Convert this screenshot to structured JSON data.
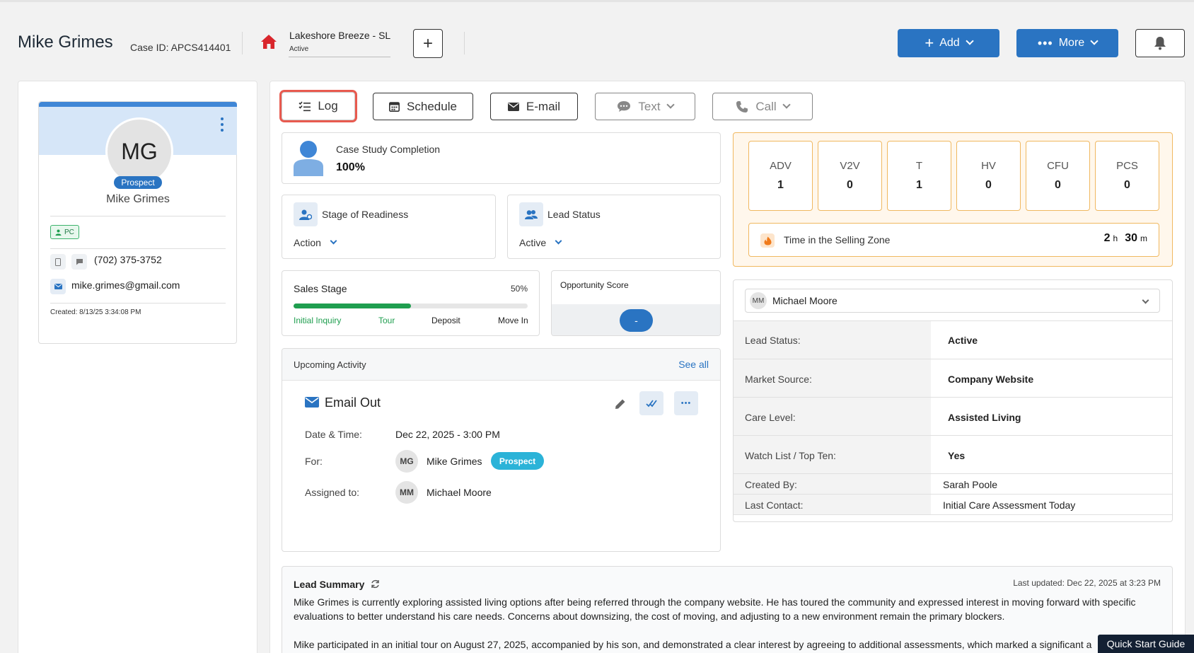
{
  "header": {
    "name": "Mike Grimes",
    "case_id": "Case ID: APCS414401",
    "community": "Lakeshore Breeze - SL",
    "community_status": "Active",
    "add_label": "Add",
    "more_label": "More"
  },
  "profile": {
    "initials": "MG",
    "badge": "Prospect",
    "name": "Mike Grimes",
    "tag": "PC",
    "phone": "(702) 375-3752",
    "email": "mike.grimes@gmail.com",
    "created": "Created: 8/13/25 3:34:08 PM"
  },
  "actions": {
    "log": "Log",
    "schedule": "Schedule",
    "email": "E-mail",
    "text": "Text",
    "call": "Call"
  },
  "case_study": {
    "label": "Case Study Completion",
    "value": "100%"
  },
  "readiness": {
    "label": "Stage of Readiness",
    "value": "Action"
  },
  "lead_status_card": {
    "label": "Lead Status",
    "value": "Active"
  },
  "sales_stage": {
    "label": "Sales Stage",
    "percent_text": "50%",
    "progress": 0.5,
    "stages": [
      "Initial Inquiry",
      "Tour",
      "Deposit",
      "Move In"
    ]
  },
  "opportunity": {
    "label": "Opportunity Score",
    "value": "-"
  },
  "upcoming": {
    "title": "Upcoming Activity",
    "see_all": "See all",
    "activity_title": "Email Out",
    "date_label": "Date & Time:",
    "date_value": "Dec 22, 2025 - 3:00 PM",
    "for_label": "For:",
    "for_initials": "MG",
    "for_name": "Mike Grimes",
    "for_badge": "Prospect",
    "assigned_label": "Assigned to:",
    "assigned_initials": "MM",
    "assigned_name": "Michael Moore"
  },
  "metrics": [
    {
      "label": "ADV",
      "value": "1"
    },
    {
      "label": "V2V",
      "value": "0"
    },
    {
      "label": "T",
      "value": "1"
    },
    {
      "label": "HV",
      "value": "0"
    },
    {
      "label": "CFU",
      "value": "0"
    },
    {
      "label": "PCS",
      "value": "0"
    }
  ],
  "selling_zone": {
    "label": "Time in the Selling Zone",
    "hours": "2",
    "h": "h",
    "minutes": "30",
    "m": "m"
  },
  "details": {
    "owner_initials": "MM",
    "owner_name": "Michael Moore",
    "rows": [
      {
        "label": "Lead Status:",
        "value": "Active"
      },
      {
        "label": "Market Source:",
        "value": "Company Website"
      },
      {
        "label": "Care Level:",
        "value": "Assisted Living"
      },
      {
        "label": "Watch List / Top Ten:",
        "value": "Yes"
      },
      {
        "label": "Created By:",
        "value": "Sarah Poole"
      },
      {
        "label": "Last Contact:",
        "value": "Initial Care Assessment Today"
      }
    ]
  },
  "summary": {
    "title": "Lead Summary",
    "updated": "Last updated: Dec 22, 2025 at 3:23 PM",
    "p1": "Mike Grimes is currently exploring assisted living options after being referred through the company website. He has toured the community and expressed interest in moving forward with specific evaluations to better understand his care needs. Concerns about downsizing, the cost of moving, and adjusting to a new environment remain the primary blockers.",
    "p2": "Mike participated in an initial tour on August 27, 2025, accompanied by his son, and demonstrated a clear interest by agreeing to additional assessments, which marked a significant a"
  },
  "quick_start": "Quick Start Guide",
  "colors": {
    "primary": "#2a74c2",
    "success": "#1f9e4f",
    "warning_border": "#f0b860",
    "highlight": "#e85a4f"
  }
}
